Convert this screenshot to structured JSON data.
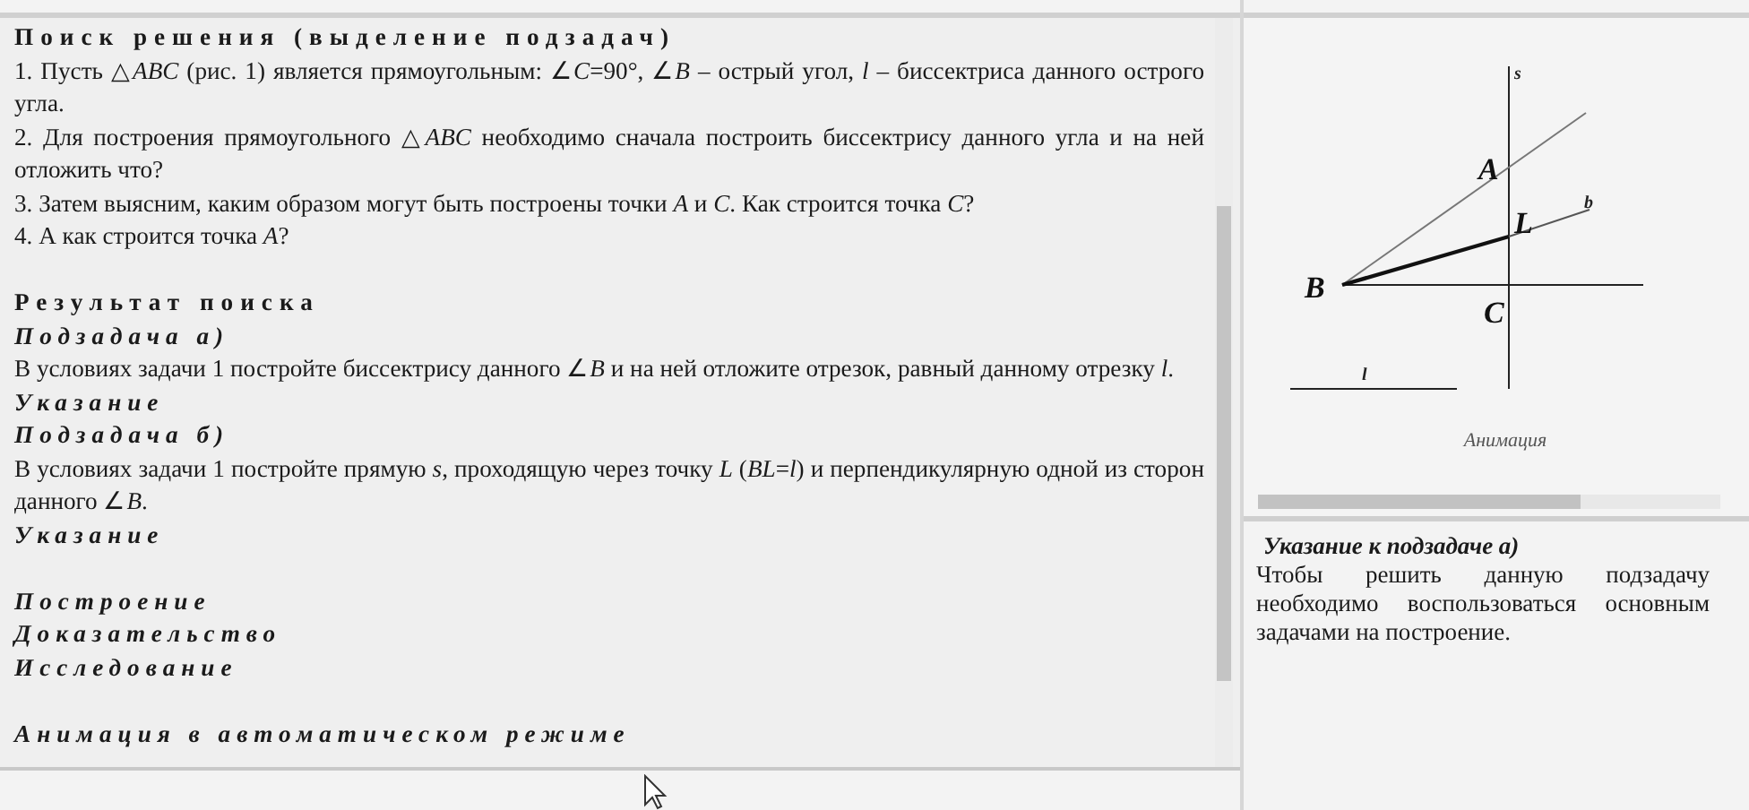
{
  "sections": [
    [
      {
        "kind": "heading",
        "text": "Поиск решения (выделение подзадач)"
      },
      {
        "kind": "text",
        "text": "1. Пусть △*ABC* (рис. 1) является прямоугольным: ∠*C*=90°, ∠*B* – острый угол, *l* – биссектриса данного острого угла."
      },
      {
        "kind": "text",
        "text": "2. Для построения прямоугольного △*ABC* необходимо сначала построить биссектрису данного угла и на ней отложить что?"
      },
      {
        "kind": "text",
        "text": "3. Затем выясним, каким образом могут быть построены точки *A* и *C*. Как строится точка *C*?"
      },
      {
        "kind": "text",
        "text": "4. А как строится точка *A*?"
      }
    ],
    [
      {
        "kind": "heading",
        "text": "Результат поиска"
      },
      {
        "kind": "subheading",
        "text": "Подзадача а)"
      },
      {
        "kind": "text",
        "text": "В условиях задачи 1 постройте биссектрису данного ∠*B* и на ней отложите отрезок, равный данному отрезку *l*."
      },
      {
        "kind": "subheading",
        "text": "Указание"
      },
      {
        "kind": "subheading",
        "text": "Подзадача б)"
      },
      {
        "kind": "text",
        "text": "В условиях задачи 1 постройте прямую *s*, проходящую через точку *L* (*BL*=*l*) и перпендикулярную одной из сторон данного ∠*B*."
      },
      {
        "kind": "subheading",
        "text": "Указание"
      }
    ],
    [
      {
        "kind": "subheading",
        "text": "Построение"
      },
      {
        "kind": "subheading",
        "text": "Доказательство"
      },
      {
        "kind": "subheading",
        "text": "Исследование"
      }
    ],
    [
      {
        "kind": "subheading",
        "text": "Анимация в автоматическом режиме"
      }
    ]
  ],
  "figure": {
    "labels": {
      "s": "s",
      "A": "A",
      "L": "L",
      "b": "b",
      "B": "B",
      "C": "C",
      "l": "l"
    },
    "caption": "Анимация"
  },
  "hint": {
    "title": "Указание к подзадаче а)",
    "text": "Чтобы решить данную подзадачу необходимо воспользоваться основным задачами на построение."
  }
}
